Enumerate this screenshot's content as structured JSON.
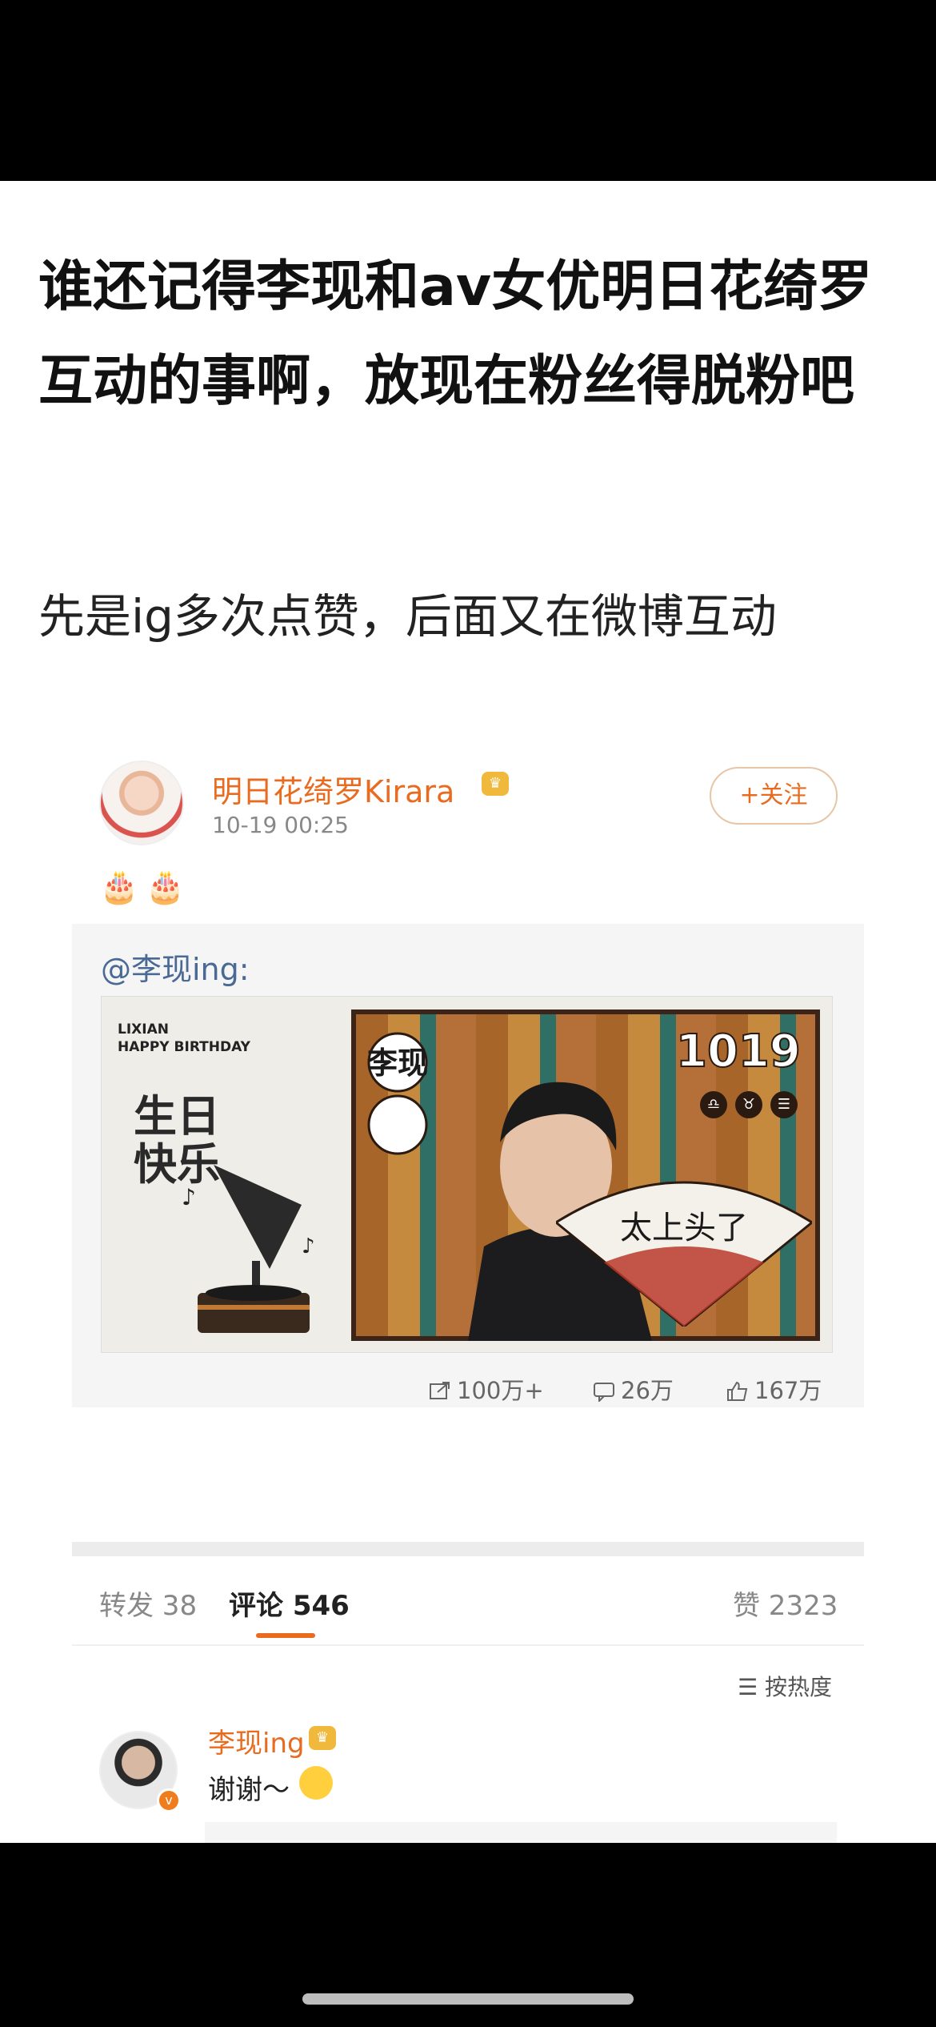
{
  "post": {
    "title": "谁还记得李现和av女优明日花绮罗互动的事啊，放现在粉丝得脱粉吧",
    "body": "先是ig多次点赞，后面又在微博互动"
  },
  "embed": {
    "author": {
      "name": "明日花绮罗Kirara",
      "time": "10-19 00:25",
      "follow_label": "+关注"
    },
    "caption_emoji": "🎂🎂",
    "repost": {
      "mention": "@李现ing:",
      "image": {
        "caption_line1": "LIXIAN",
        "caption_line2": "HAPPY BIRTHDAY",
        "left_text": "生日快乐",
        "name_chars": "李现",
        "date": "1019",
        "fan_text": "太上头了"
      },
      "stats": {
        "reposts": "100万+",
        "comments": "26万",
        "likes": "167万"
      }
    },
    "tabs": {
      "repost": "转发 38",
      "comments": "评论 546",
      "likes": "赞 2323"
    },
    "sort_label": "按热度",
    "comment": {
      "user": "李现ing",
      "text": "谢谢～"
    }
  },
  "colors": {
    "accent": "#e86b1f",
    "mention": "#4a6a95"
  }
}
